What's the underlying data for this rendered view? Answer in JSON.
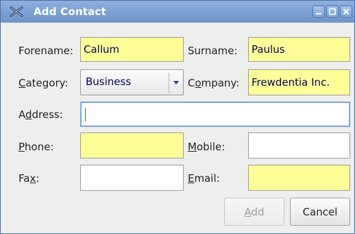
{
  "window": {
    "title": "Add Contact"
  },
  "form": {
    "forename": {
      "label": "Forename:",
      "value": "Callum"
    },
    "surname": {
      "label": "Surname:",
      "value": "Paulus"
    },
    "category": {
      "label_pre": "",
      "label_ul": "C",
      "label_post": "ategory:",
      "value": "Business"
    },
    "company": {
      "label_pre": "C",
      "label_ul": "o",
      "label_post": "mpany:",
      "value": "Frewdentia Inc."
    },
    "address": {
      "label_pre": "A",
      "label_ul": "d",
      "label_post": "dress:",
      "value": ""
    },
    "phone": {
      "label_pre": "",
      "label_ul": "P",
      "label_post": "hone:",
      "value": ""
    },
    "mobile": {
      "label_pre": "",
      "label_ul": "M",
      "label_post": "obile:",
      "value": ""
    },
    "fax": {
      "label_pre": "Fa",
      "label_ul": "x",
      "label_post": ":",
      "value": ""
    },
    "email": {
      "label_pre": "",
      "label_ul": "E",
      "label_post": "mail:",
      "value": ""
    }
  },
  "buttons": {
    "add": {
      "label_ul": "A",
      "label_post": "dd"
    },
    "cancel": {
      "label": "Cancel"
    }
  },
  "colors": {
    "required_field": "#ffff99",
    "titlebar": "#7a9fd4",
    "focus_border": "#7aa6dd"
  }
}
